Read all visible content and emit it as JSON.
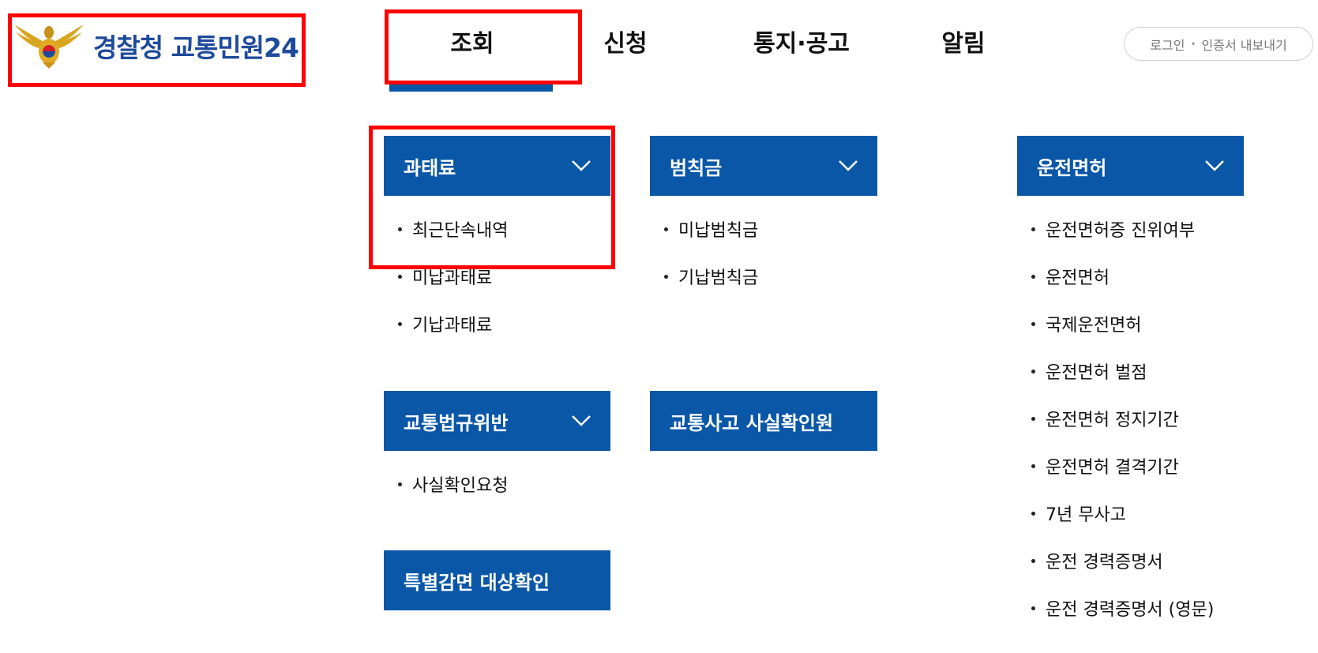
{
  "header": {
    "logo_text": "경찰청 교통민원24",
    "nav": [
      "조회",
      "신청",
      "통지·공고",
      "알림"
    ],
    "login": {
      "label": "로그인",
      "separator": "•",
      "cert_label": "인증서 내보내기"
    }
  },
  "menu": {
    "penalty": {
      "title": "과태료",
      "items": [
        "최근단속내역",
        "미납과태료",
        "기납과태료"
      ]
    },
    "fine": {
      "title": "범칙금",
      "items": [
        "미납범칙금",
        "기납범칙금"
      ]
    },
    "license": {
      "title": "운전면허",
      "items": [
        "운전면허증 진위여부",
        "운전면허",
        "국제운전면허",
        "운전면허 벌점",
        "운전면허 정지기간",
        "운전면허 결격기간",
        "7년 무사고",
        "운전 경력증명서",
        "운전 경력증명서 (영문)"
      ]
    },
    "violation": {
      "title": "교통법규위반",
      "items": [
        "사실확인요청"
      ]
    },
    "accident": {
      "title": "교통사고 사실확인원"
    },
    "special": {
      "title": "특별감면 대상확인"
    }
  },
  "colors": {
    "primary": "#0a57a8",
    "logo_text": "#1e4a9c",
    "highlight": "#ff0000"
  },
  "icons": {
    "emblem": "police-eagle-emblem-icon",
    "chevron": "chevron-down-icon"
  }
}
